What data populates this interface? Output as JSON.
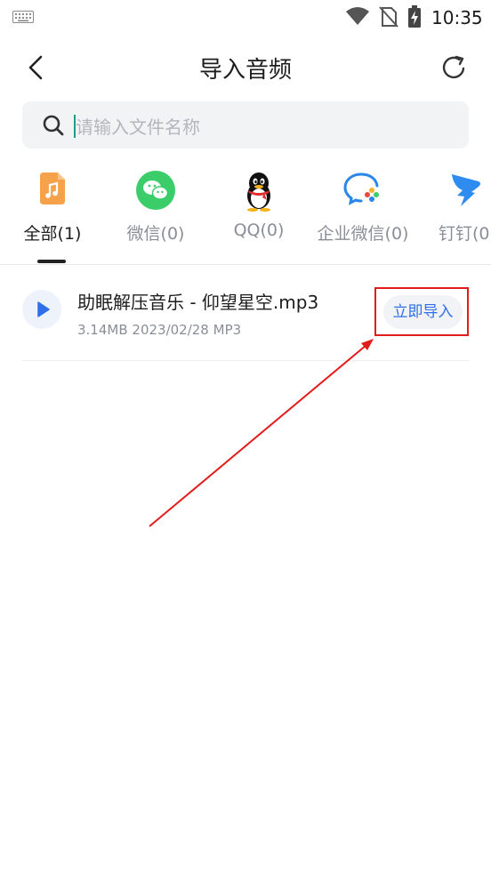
{
  "status_bar": {
    "time": "10:35",
    "icons": [
      "keyboard-icon",
      "wifi-icon",
      "no-sim-icon",
      "battery-charging-icon"
    ]
  },
  "header": {
    "title": "导入音频",
    "back_icon": "back-arrow-icon",
    "refresh_icon": "refresh-icon"
  },
  "search": {
    "placeholder": "请输入文件名称",
    "value": ""
  },
  "tabs": [
    {
      "label": "全部(1)",
      "icon": "music-file-icon",
      "active": true
    },
    {
      "label": "微信(0)",
      "icon": "wechat-icon",
      "active": false
    },
    {
      "label": "QQ(0)",
      "icon": "qq-icon",
      "active": false
    },
    {
      "label": "企业微信(0)",
      "icon": "wecom-icon",
      "active": false
    },
    {
      "label": "钉钉(0",
      "icon": "dingtalk-icon",
      "active": false
    }
  ],
  "files": [
    {
      "name": "助眠解压音乐 - 仰望星空.mp3",
      "meta": "3.14MB 2023/02/28 MP3",
      "action": "立即导入"
    }
  ],
  "colors": {
    "accent": "#2f6fe8",
    "highlight": "#e21b1b",
    "wechat": "#3ccd6b",
    "music_file": "#f6a24b"
  }
}
